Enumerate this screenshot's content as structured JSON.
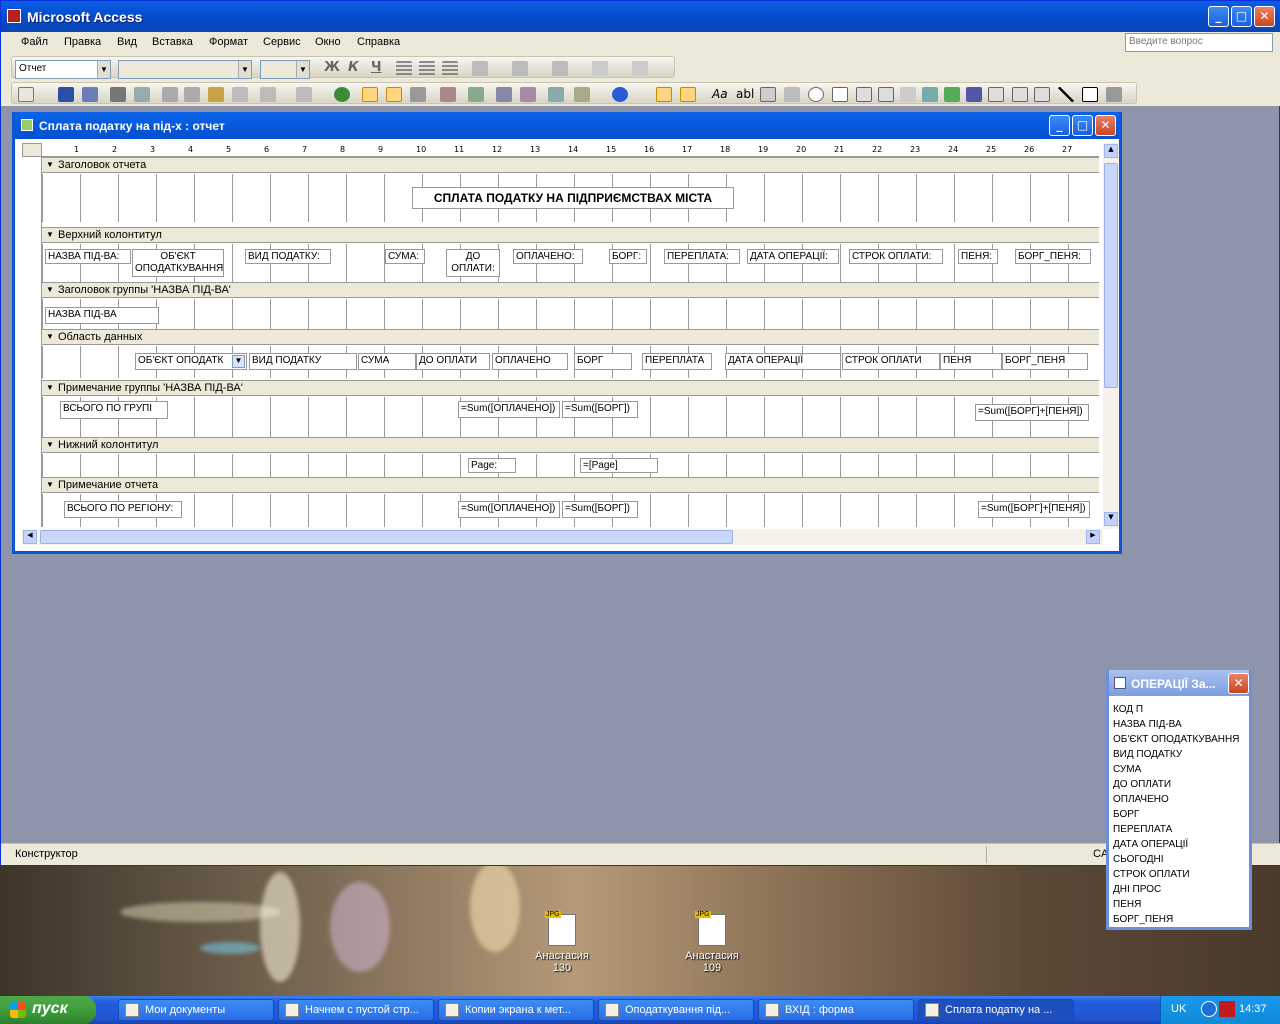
{
  "app": {
    "title": "Microsoft Access"
  },
  "menus": [
    "Файл",
    "Правка",
    "Вид",
    "Вставка",
    "Формат",
    "Сервис",
    "Окно",
    "Справка"
  ],
  "ask_placeholder": "Введите вопрос",
  "toolbar": {
    "object_combo": "Отчет",
    "font_combo": "",
    "size_combo": "",
    "bold": "Ж",
    "italic": "К",
    "underline": "Ч",
    "tool_aa": "Aa",
    "tool_abl": "abl"
  },
  "report_window": {
    "title": "Сплата податку на під-х : отчет",
    "ruler": [
      "1",
      "2",
      "3",
      "4",
      "5",
      "6",
      "7",
      "8",
      "9",
      "10",
      "11",
      "12",
      "13",
      "14",
      "15",
      "16",
      "17",
      "18",
      "19",
      "20",
      "21",
      "22",
      "23",
      "24",
      "25",
      "26",
      "27",
      "2"
    ],
    "bands": {
      "report_header": "Заголовок отчета",
      "page_header": "Верхний колонтитул",
      "group_header": "Заголовок группы 'НАЗВА ПІД-ВА'",
      "detail": "Область данных",
      "group_footer": "Примечание группы 'НАЗВА ПІД-ВА'",
      "page_footer": "Нижний колонтитул",
      "report_footer": "Примечание отчета"
    },
    "report_title": "СПЛАТА ПОДАТКУ НА ПІДПРИЄМСТВАХ МІСТА",
    "page_header_labels": [
      "НАЗВА ПІД-ВА:",
      "ОБ'ЄКТ ОПОДАТКУВАННЯ:",
      "ВИД ПОДАТКУ:",
      "СУМА:",
      "ДО ОПЛАТИ:",
      "ОПЛАЧЕНО:",
      "БОРГ:",
      "ПЕРЕПЛАТА:",
      "ДАТА ОПЕРАЦІЇ:",
      "СТРОК ОПЛАТИ:",
      "ПЕНЯ:",
      "БОРГ_ПЕНЯ:"
    ],
    "group_header_field": "НАЗВА ПІД-ВА",
    "detail_fields": [
      "ОБ'ЄКТ ОПОДАТК",
      "ВИД ПОДАТКУ",
      "СУМА",
      "ДО ОПЛАТИ",
      "ОПЛАЧЕНО",
      "БОРГ",
      "ПЕРЕПЛАТА",
      "ДАТА ОПЕРАЦІЇ",
      "СТРОК ОПЛАТИ",
      "ПЕНЯ",
      "БОРГ_ПЕНЯ"
    ],
    "group_footer": {
      "label": "ВСЬОГО ПО ГРУПІ",
      "sum_paid": "=Sum([ОПЛАЧЕНО])",
      "sum_debt": "=Sum([БОРГ])",
      "sum_total": "=Sum([БОРГ]+[ПЕНЯ])"
    },
    "page_footer": {
      "label": "Page:",
      "expr": "=[Page]"
    },
    "report_footer": {
      "label": "ВСЬОГО ПО РЕГІОНУ:",
      "sum_paid": "=Sum([ОПЛАЧЕНО])",
      "sum_debt": "=Sum([БОРГ])",
      "sum_total": "=Sum([БОРГ]+[ПЕНЯ])"
    }
  },
  "status": {
    "mode": "Конструктор",
    "caps": "CA"
  },
  "field_list": {
    "title": "ОПЕРАЦІЇ За...",
    "items": [
      "КОД П",
      "НАЗВА ПІД-ВА",
      "ОБ'ЄКТ ОПОДАТКУВАННЯ",
      "ВИД ПОДАТКУ",
      "СУМА",
      "ДО ОПЛАТИ",
      "ОПЛАЧЕНО",
      "БОРГ",
      "ПЕРЕПЛАТА",
      "ДАТА ОПЕРАЦІЇ",
      "СЬОГОДНІ",
      "СТРОК ОПЛАТИ",
      "ДНІ ПРОС",
      "ПЕНЯ",
      "БОРГ_ПЕНЯ"
    ]
  },
  "desktop_icons": [
    {
      "line1": "Анастасия",
      "line2": "130"
    },
    {
      "line1": "Анастасия",
      "line2": "109"
    }
  ],
  "taskbar": {
    "start": "пуск",
    "items": [
      "Мои документы",
      "Начнем с пустой стр...",
      "Копии экрана к мет...",
      "Оподаткування під...",
      "ВХІД : форма",
      "Сплата податку на ..."
    ],
    "lang": "UK",
    "clock": "14:37"
  },
  "colors": {
    "title_blue": "#0a5ee6",
    "menu_bg": "#ece9d8",
    "desktop_bg": "#8e95ab",
    "start_green": "#3c9a3a"
  }
}
